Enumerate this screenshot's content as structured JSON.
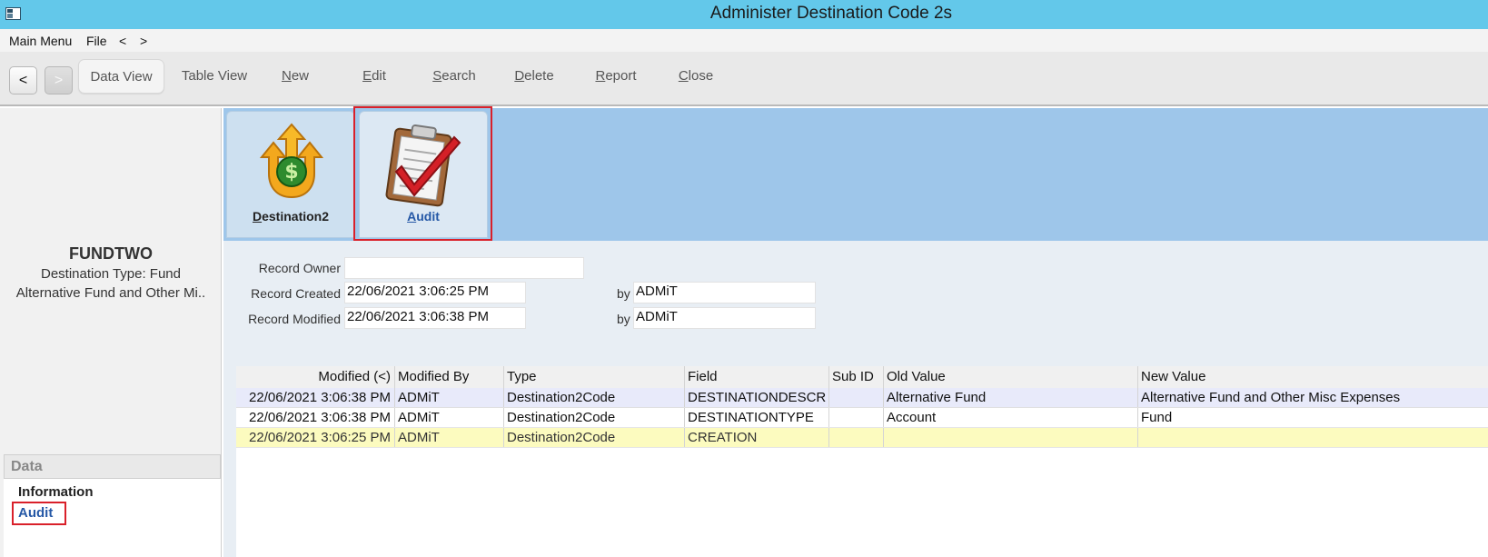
{
  "window": {
    "title": "Administer Destination Code 2s"
  },
  "menu": {
    "items": [
      "Main Menu",
      "File",
      "<",
      ">"
    ]
  },
  "toolbar": {
    "back_label": "<",
    "forward_label": ">",
    "buttons": [
      {
        "label": "Data View",
        "active": true
      },
      {
        "label": "Table View"
      },
      {
        "label": "New",
        "mnemonic": "N"
      },
      {
        "label": "Edit",
        "mnemonic": "E"
      },
      {
        "label": "Search",
        "mnemonic": "S"
      },
      {
        "label": "Delete",
        "mnemonic": "D"
      },
      {
        "label": "Report",
        "mnemonic": "R"
      },
      {
        "label": "Close",
        "mnemonic": "C"
      }
    ]
  },
  "record": {
    "name": "FUNDTWO",
    "type_line": "Destination Type: Fund",
    "description": "Alternative Fund and Other Mi.."
  },
  "data_section": {
    "header": "Data",
    "items": [
      "Information",
      "Audit"
    ]
  },
  "tabs": [
    {
      "label": "Destination2",
      "mnemonic": "D",
      "icon": "money-arrows-icon"
    },
    {
      "label": "Audit",
      "mnemonic": "A",
      "icon": "clipboard-check-icon",
      "selected": true
    }
  ],
  "audit_form": {
    "owner_label": "Record Owner",
    "owner_value": "",
    "created_label": "Record Created",
    "created_value": "22/06/2021 3:06:25 PM",
    "created_by_label": "by",
    "created_by_value": "ADMiT",
    "modified_label": "Record Modified",
    "modified_value": "22/06/2021 3:06:38 PM",
    "modified_by_label": "by",
    "modified_by_value": "ADMiT"
  },
  "audit_grid": {
    "columns": [
      "Modified (<)",
      "Modified By",
      "Type",
      "Field",
      "Sub ID",
      "Old Value",
      "New Value"
    ],
    "rows": [
      [
        "22/06/2021 3:06:38 PM",
        "ADMiT",
        "Destination2Code",
        "DESTINATIONDESCR",
        "",
        "Alternative Fund",
        "Alternative Fund and Other Misc Expenses"
      ],
      [
        "22/06/2021 3:06:38 PM",
        "ADMiT",
        "Destination2Code",
        "DESTINATIONTYPE",
        "",
        "Account",
        "Fund"
      ],
      [
        "22/06/2021 3:06:25 PM",
        "ADMiT",
        "Destination2Code",
        "CREATION",
        "",
        "",
        ""
      ]
    ]
  },
  "colors": {
    "titlebar": "#63c8ea",
    "tab_strip": "#9ec6ea",
    "highlight": "#d9202a",
    "selected_link": "#2558a6"
  }
}
